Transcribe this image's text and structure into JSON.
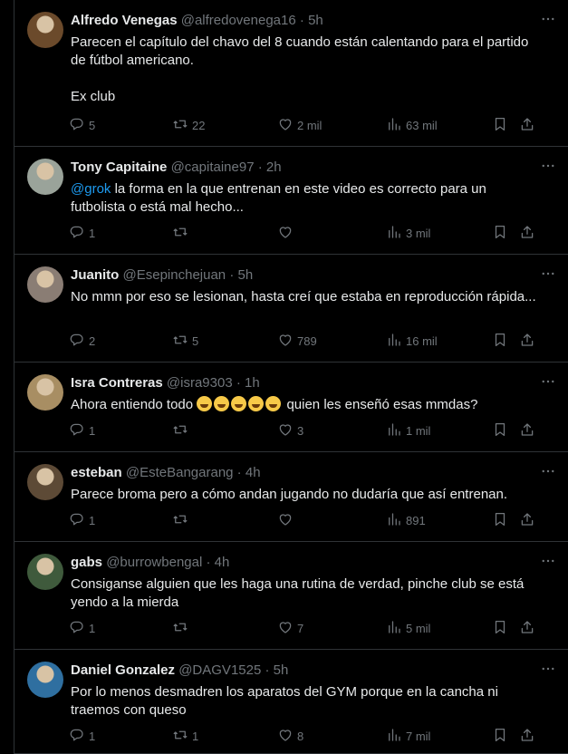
{
  "tweets": [
    {
      "name": "Alfredo Venegas",
      "handle": "@alfredovenega16",
      "time": "5h",
      "lines": [
        "Parecen el capítulo del chavo del 8 cuando están calentando para el partido de fútbol americano.",
        "",
        "Ex club"
      ],
      "replies": "5",
      "retweets": "22",
      "likes": "2 mil",
      "views": "63 mil",
      "avatar_color": "#6b4a2b"
    },
    {
      "name": "Tony Capitaine",
      "handle": "@capitaine97",
      "time": "2h",
      "mention": "@grok",
      "text": " la forma en la que entrenan en este video es correcto para un futbolista o está mal hecho...",
      "replies": "1",
      "retweets": "",
      "likes": "",
      "views": "3 mil",
      "avatar_color": "#9aa39a"
    },
    {
      "name": "Juanito",
      "handle": "@Esepinchejuan",
      "time": "5h",
      "text": "No mmn por eso se lesionan, hasta creí que estaba en reproducción rápida...",
      "replies": "2",
      "retweets": "5",
      "likes": "789",
      "views": "16 mil",
      "avatar_color": "#8a7d74"
    },
    {
      "name": "Isra Contreras",
      "handle": "@isra9303",
      "time": "1h",
      "text_before": "Ahora entiendo todo ",
      "text_after": " quien les enseñó esas mmdas?",
      "emoji_count": 5,
      "replies": "1",
      "retweets": "",
      "likes": "3",
      "views": "1 mil",
      "avatar_color": "#a88e63"
    },
    {
      "name": "esteban",
      "handle": "@EsteBangarang",
      "time": "4h",
      "text": "Parece broma pero a cómo andan jugando no dudaría que así entrenan.",
      "replies": "1",
      "retweets": "",
      "likes": "",
      "views": "891",
      "avatar_color": "#5d4a36"
    },
    {
      "name": "gabs",
      "handle": "@burrowbengal",
      "time": "4h",
      "text": "Consiganse alguien que les haga una rutina de verdad, pinche club se está yendo a la mierda",
      "replies": "1",
      "retweets": "",
      "likes": "7",
      "views": "5 mil",
      "avatar_color": "#3f5a3c"
    },
    {
      "name": "Daniel Gonzalez",
      "handle": "@DAGV1525",
      "time": "5h",
      "text": "Por lo menos desmadren los aparatos del GYM porque en la cancha ni traemos con queso",
      "replies": "1",
      "retweets": "1",
      "likes": "8",
      "views": "7 mil",
      "avatar_color": "#2f6fa0"
    }
  ]
}
